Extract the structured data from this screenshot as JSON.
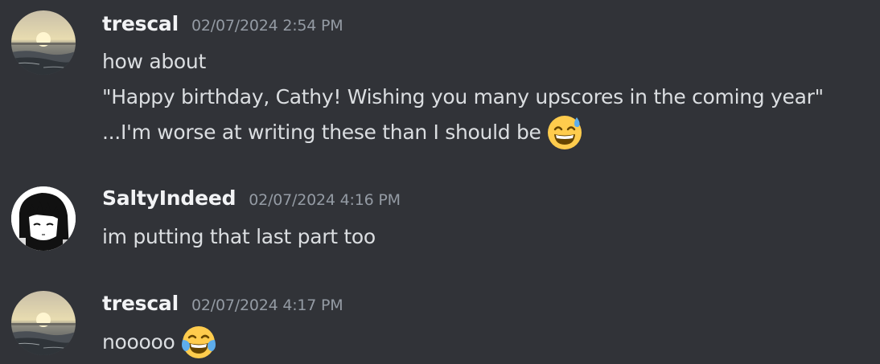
{
  "messages": [
    {
      "author": "trescal",
      "timestamp": "02/07/2024 2:54 PM",
      "avatar_icon": "sunset-beach-avatar",
      "lines": [
        "how about",
        "\"Happy birthday, Cathy! Wishing you many upscores in the coming year\"",
        "...I'm worse at writing these than I should be"
      ],
      "emoji": "grinning-sweat-emoji"
    },
    {
      "author": "SaltyIndeed",
      "timestamp": "02/07/2024 4:16 PM",
      "avatar_icon": "manga-character-avatar",
      "lines": [
        "im putting that last part too"
      ]
    },
    {
      "author": "trescal",
      "timestamp": "02/07/2024 4:17 PM",
      "avatar_icon": "sunset-beach-avatar",
      "lines": [
        "nooooo"
      ],
      "emoji": "tears-of-joy-emoji"
    }
  ],
  "colors": {
    "background": "#313338",
    "username": "#f2f3f5",
    "timestamp": "#949ba4",
    "message_text": "#dbdee1"
  }
}
